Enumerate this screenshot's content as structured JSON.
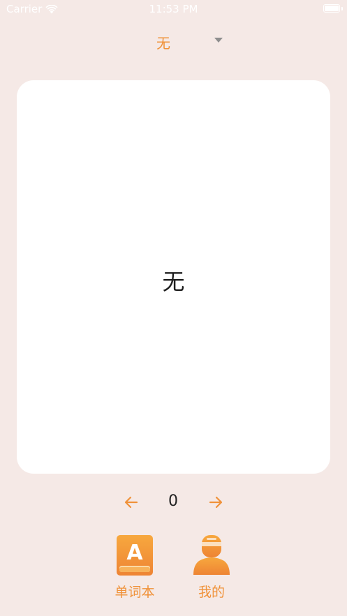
{
  "status_bar": {
    "carrier": "Carrier",
    "time": "11:53 PM"
  },
  "selector": {
    "current": "无"
  },
  "card": {
    "word": "无"
  },
  "pager": {
    "index": "0"
  },
  "tabs": [
    {
      "label": "单词本",
      "icon": "wordbook-icon"
    },
    {
      "label": "我的",
      "icon": "profile-icon"
    }
  ],
  "colors": {
    "background": "#f5e9e6",
    "accent": "#f0923a",
    "card": "#ffffff"
  }
}
